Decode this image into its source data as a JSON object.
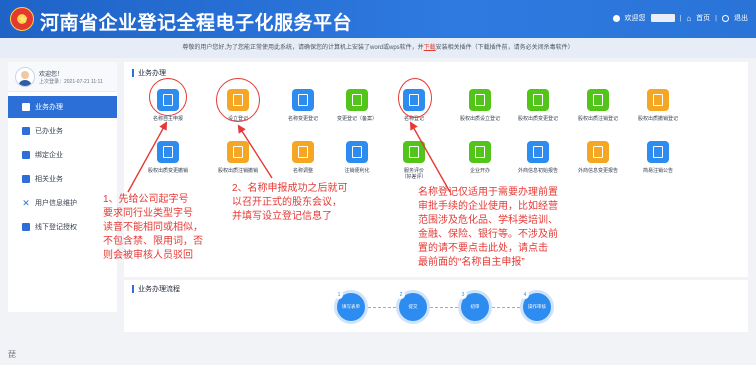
{
  "header": {
    "title": "河南省企业登记全程电子化服务平台",
    "welcome": "欢迎您",
    "home": "首页",
    "logout": "退出"
  },
  "notice": {
    "text_before": "尊敬的用户您好,为了您能正常使用此系统，请确保您的计算机上安装了word或wps软件，并",
    "download": "下载",
    "text_after": "安装相关插件（下载插件前，请务必关闭杀毒软件）"
  },
  "sidebar": {
    "greeting": "欢迎您！",
    "last_login": "上次登录：2021-07-21 11:11",
    "items": [
      {
        "label": "业务办理"
      },
      {
        "label": "已办业务"
      },
      {
        "label": "绑定企业"
      },
      {
        "label": "相关业务"
      },
      {
        "label": "用户信息维护"
      },
      {
        "label": "线下登记授权"
      }
    ]
  },
  "sections": {
    "business": "业务办理",
    "flow": "业务办理流程"
  },
  "services_row1": [
    {
      "label": "名称自主申报",
      "color": "#2d8cf0"
    },
    {
      "label": "设立登记",
      "color": "#f5a623"
    },
    {
      "label": "名称变更登记",
      "color": "#2d8cf0"
    },
    {
      "label": "变更登记（备案）",
      "color": "#52c41a"
    },
    {
      "label": "名称登记",
      "color": "#2d8cf0"
    },
    {
      "label": "股权出质设立登记",
      "color": "#52c41a"
    },
    {
      "label": "股权出质变更登记",
      "color": "#52c41a"
    },
    {
      "label": "股权出质注销登记",
      "color": "#52c41a"
    },
    {
      "label": "股权出质撤销登记",
      "color": "#f5a623"
    }
  ],
  "services_row2": [
    {
      "label": "股权出质变更撤销",
      "color": "#2d8cf0",
      "sub": ""
    },
    {
      "label": "股权出质注销撤销",
      "color": "#f5a623",
      "sub": ""
    },
    {
      "label": "名称调整",
      "color": "#f5a623",
      "sub": ""
    },
    {
      "label": "注销便利化",
      "color": "#2d8cf0",
      "sub": ""
    },
    {
      "label": "服务评价",
      "color": "#52c41a",
      "sub": "（好差评）"
    },
    {
      "label": "企业开办",
      "color": "#52c41a",
      "sub": ""
    },
    {
      "label": "外商信息初始报告",
      "color": "#2d8cf0",
      "sub": ""
    },
    {
      "label": "外商信息变更报告",
      "color": "#f5a623",
      "sub": ""
    },
    {
      "label": "简易注销公告",
      "color": "#2d8cf0",
      "sub": ""
    }
  ],
  "flow_steps": [
    {
      "num": "1",
      "label": "填写表单"
    },
    {
      "num": "2",
      "label": "提交"
    },
    {
      "num": "3",
      "label": "初审"
    },
    {
      "num": "4",
      "label": "操作审核"
    }
  ],
  "annotations": {
    "a1": [
      "1、先给公司起字号",
      "要求同行业类型字号",
      "读音不能相同或相似，",
      "不包含禁、限用词，否",
      "则会被审核人员驳回"
    ],
    "a2": [
      "2、名称申报成功之后就可",
      "以召开正式的股东会议，",
      "并填写设立登记信息了"
    ],
    "a3": [
      "名称登记仅适用于需要办理前置",
      "审批手续的企业使用，比如经营",
      "范围涉及危化品、学科类培训、",
      "金融、保险、银行等。不涉及前",
      "置的请不要点击此处，请点击",
      "最前面的“名称自主申报”"
    ]
  },
  "footer_glyph": "琵"
}
